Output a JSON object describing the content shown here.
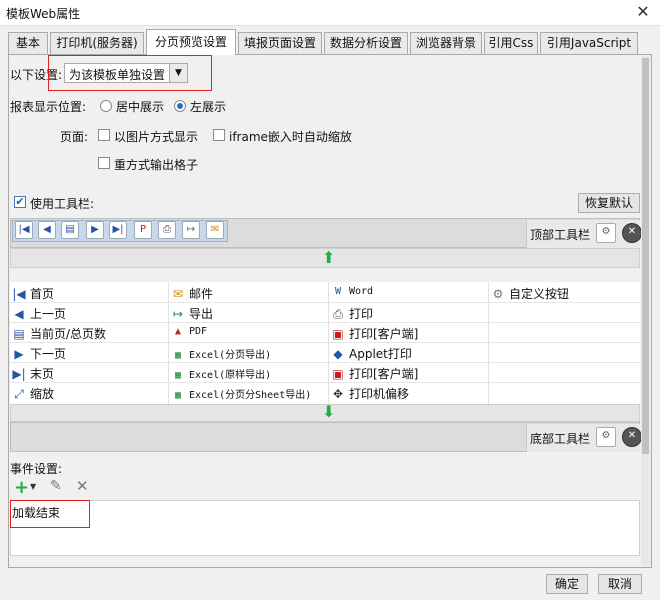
{
  "window": {
    "title": "模板Web属性"
  },
  "tabs": [
    {
      "label": "基本"
    },
    {
      "label": "打印机(服务器)"
    },
    {
      "label": "分页预览设置"
    },
    {
      "label": "填报页面设置"
    },
    {
      "label": "数据分析设置"
    },
    {
      "label": "浏览器背景"
    },
    {
      "label": "引用Css"
    },
    {
      "label": "引用JavaScript"
    }
  ],
  "settings": {
    "scope_label": "以下设置:",
    "scope_value": "为该模板单独设置",
    "position_label": "报表显示位置:",
    "position_center": "居中展示",
    "position_left": "左展示",
    "page_label": "页面:",
    "opt_image": "以图片方式显示",
    "opt_iframe": "iframe嵌入时自动缩放",
    "opt_repeat": "重方式输出格子",
    "use_toolbar": "使用工具栏:",
    "restore_default": "恢复默认"
  },
  "toolbars": {
    "top_label": "顶部工具栏",
    "bottom_label": "底部工具栏"
  },
  "buttons_grid": {
    "col1": [
      "首页",
      "上一页",
      "当前页/总页数",
      "下一页",
      "末页",
      "缩放"
    ],
    "col2": [
      "邮件",
      "导出",
      "PDF",
      "Excel(分页导出)",
      "Excel(原样导出)",
      "Excel(分页分Sheet导出)"
    ],
    "col3": [
      "Word",
      "打印",
      "打印[客户端]",
      "Applet打印",
      "打印[客户端]",
      "打印机偏移"
    ],
    "col4": [
      "自定义按钮"
    ]
  },
  "events": {
    "label": "事件设置:",
    "item": "加载结束"
  },
  "footer": {
    "ok": "确定",
    "cancel": "取消"
  }
}
